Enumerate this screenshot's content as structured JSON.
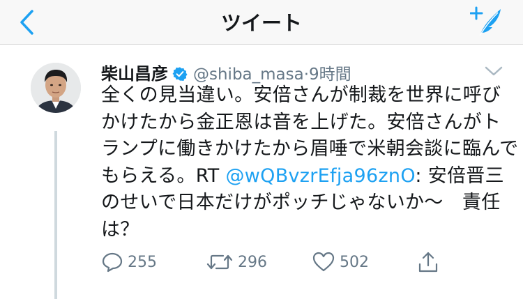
{
  "header": {
    "title": "ツイート"
  },
  "tweet": {
    "author_name": "柴山昌彦",
    "handle": "@shiba_masa",
    "separator": "·",
    "time": "9時間",
    "text_before": "全くの見当違い。安倍さんが制裁を世界に呼びかけたから金正恩は音を上げた。安倍さんがトランプに働きかけたから眉唾で米朝会談に臨んでもらえる。RT ",
    "mention": "@wQBvzrEfja96znO",
    "text_after": ": 安倍晋三のせいで日本だけがポッチじゃないか〜　責任は？",
    "reply_count": "255",
    "retweet_count": "296",
    "like_count": "502"
  },
  "colors": {
    "accent": "#1da1f2",
    "muted": "#657786",
    "text": "#14171a"
  }
}
